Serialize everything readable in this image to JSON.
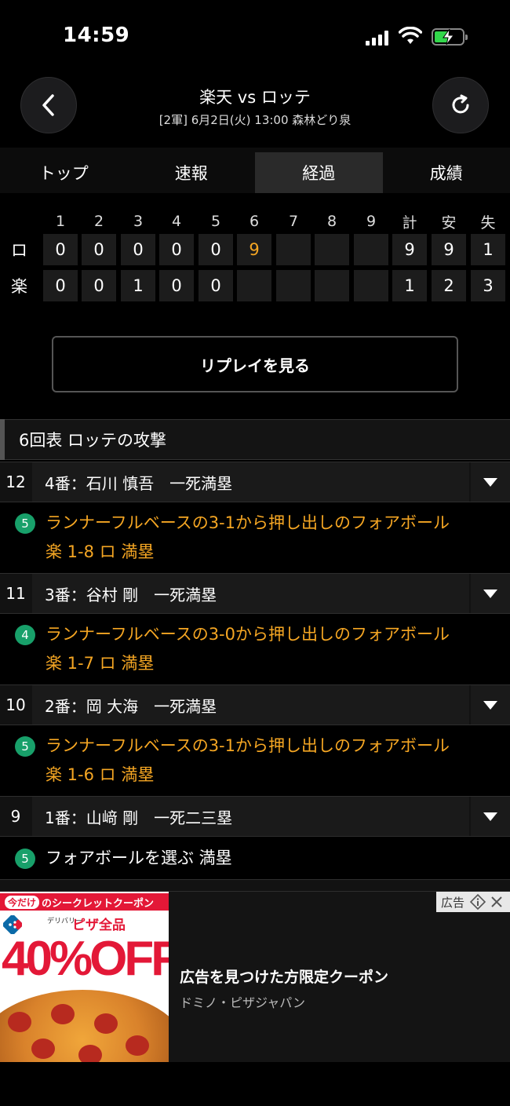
{
  "status_bar": {
    "time": "14:59"
  },
  "header": {
    "title": "楽天 vs ロッテ",
    "subtitle": "[2軍] 6月2日(火) 13:00 森林どり泉"
  },
  "tabs": [
    {
      "label": "トップ",
      "active": false
    },
    {
      "label": "速報",
      "active": false
    },
    {
      "label": "経過",
      "active": true
    },
    {
      "label": "成績",
      "active": false
    }
  ],
  "scoreboard": {
    "headers": [
      "1",
      "2",
      "3",
      "4",
      "5",
      "6",
      "7",
      "8",
      "9",
      "計",
      "安",
      "失"
    ],
    "rows": [
      {
        "team": "ロ",
        "innings": [
          "0",
          "0",
          "0",
          "0",
          "0",
          "9",
          "",
          "",
          ""
        ],
        "totals": [
          "9",
          "9",
          "1"
        ],
        "highlight_inning": 6
      },
      {
        "team": "楽",
        "innings": [
          "0",
          "0",
          "1",
          "0",
          "0",
          "",
          "",
          "",
          ""
        ],
        "totals": [
          "1",
          "2",
          "3"
        ]
      }
    ]
  },
  "replay_button": "リプレイを見る",
  "inning_title": "6回表 ロッテの攻撃",
  "plays": [
    {
      "num": "12",
      "batter": "4番：石川 慎吾　一死満塁",
      "badge": "5",
      "line1": "ランナーフルベースの3-1から押し出しのフォアボール",
      "line2": "楽 1-8 ロ 満塁",
      "highlight": true
    },
    {
      "num": "11",
      "batter": "3番：谷村 剛　一死満塁",
      "badge": "4",
      "line1": "ランナーフルベースの3-0から押し出しのフォアボール",
      "line2": "楽 1-7 ロ 満塁",
      "highlight": true
    },
    {
      "num": "10",
      "batter": "2番：岡 大海　一死満塁",
      "badge": "5",
      "line1": "ランナーフルベースの3-1から押し出しのフォアボール",
      "line2": "楽 1-6 ロ 満塁",
      "highlight": true
    },
    {
      "num": "9",
      "batter": "1番：山﨑 剛　一死二三塁",
      "badge": "5",
      "line1": "フォアボールを選ぶ 満塁",
      "line2": "",
      "highlight": false
    }
  ],
  "ad": {
    "tag_highlight": "今だけ",
    "tag_text": "のシークレットクーポン",
    "brand_small": "デリバリー",
    "pizza_label": "ピザ全品",
    "discount": "40%OFF",
    "mark": "広告",
    "title": "広告を見つけた方限定クーポン",
    "source": "ドミノ・ピザジャパン"
  },
  "colors": {
    "accent": "#f5a623",
    "badge": "#18a06a",
    "ad_red": "#e31837"
  }
}
